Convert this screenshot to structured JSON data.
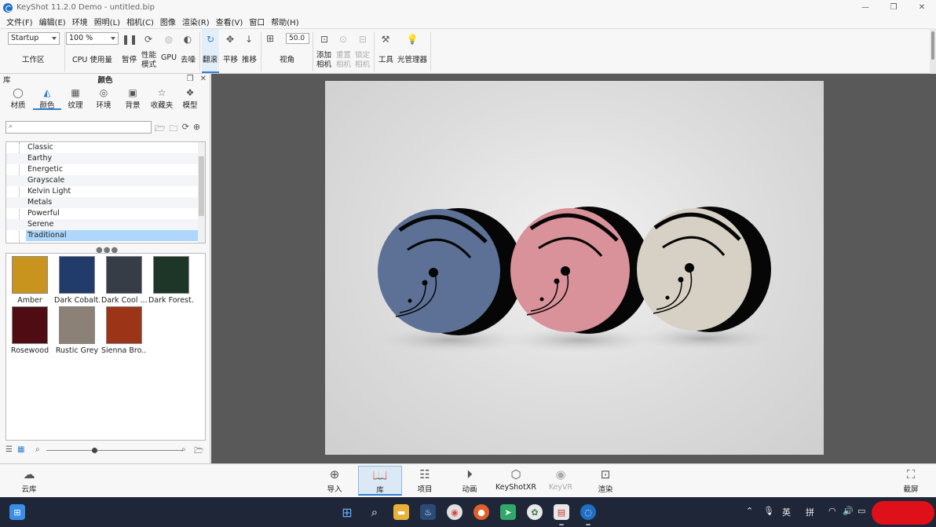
{
  "window": {
    "title": "KeyShot 11.2.0 Demo - untitled.bip",
    "controls": {
      "minimize": "—",
      "restore": "❐",
      "close": "✕"
    }
  },
  "menu": [
    "文件(F)",
    "编辑(E)",
    "环境",
    "照明(L)",
    "相机(C)",
    "图像",
    "渲染(R)",
    "查看(V)",
    "窗口",
    "帮助(H)"
  ],
  "toolbar": {
    "workspace_value": "Startup",
    "workspace_label": "工作区",
    "cpu_value": "100 %",
    "cpu_label": "CPU 使用量",
    "pause_label": "暂停",
    "perf_label_1": "性能",
    "perf_label_2": "模式",
    "gpu_label": "GPU",
    "denoise_label": "去噪",
    "tumble_label": "翻滚",
    "pan_label": "平移",
    "dolly_label": "推移",
    "fov_value": "50.0",
    "fov_label": "视角",
    "add_cam_1": "添加",
    "add_cam_2": "相机",
    "reset_cam_1": "重置",
    "reset_cam_2": "相机",
    "lock_cam_1": "锁定",
    "lock_cam_2": "相机",
    "tools_label": "工具",
    "light_manager_label": "光管理器"
  },
  "library": {
    "header_left": "库",
    "header_title": "颜色",
    "tabs": [
      {
        "label": "材质",
        "icon": "material-icon"
      },
      {
        "label": "颜色",
        "icon": "color-icon"
      },
      {
        "label": "纹理",
        "icon": "texture-icon"
      },
      {
        "label": "环境",
        "icon": "environment-icon"
      },
      {
        "label": "背景",
        "icon": "background-icon"
      },
      {
        "label": "收藏夹",
        "icon": "favorites-icon"
      },
      {
        "label": "模型",
        "icon": "models-icon"
      }
    ],
    "search_placeholder": "",
    "tree": [
      "Classic",
      "Earthy",
      "Energetic",
      "Grayscale",
      "Kelvin Light",
      "Metals",
      "Powerful",
      "Serene",
      "Traditional"
    ],
    "selected_tree": "Traditional",
    "swatches": [
      {
        "label": "Amber",
        "color": "#c8941e"
      },
      {
        "label": "Dark Cobalt...",
        "color": "#213c6a"
      },
      {
        "label": "Dark Cool ...",
        "color": "#363d46"
      },
      {
        "label": "Dark Forest...",
        "color": "#1d3627"
      },
      {
        "label": "Rosewood",
        "color": "#4f0c12"
      },
      {
        "label": "Rustic Grey",
        "color": "#8b8177"
      },
      {
        "label": "Sienna Bro...",
        "color": "#9c3418"
      }
    ],
    "thumb_size": 0.35
  },
  "dock": {
    "cloud_label": "云库",
    "items": [
      {
        "label": "导入",
        "icon": "import-icon"
      },
      {
        "label": "库",
        "icon": "library-icon"
      },
      {
        "label": "项目",
        "icon": "project-icon"
      },
      {
        "label": "动画",
        "icon": "animation-icon"
      },
      {
        "label": "KeyShotXR",
        "icon": "keyshotxr-icon"
      },
      {
        "label": "KeyVR",
        "icon": "keyvr-icon"
      },
      {
        "label": "渲染",
        "icon": "render-icon"
      }
    ],
    "screenshot_label": "截屏"
  },
  "taskbar": {
    "ime_lang": "英",
    "ime_mode": "拼"
  },
  "scene": {
    "discs": [
      {
        "face": "#5d7196"
      },
      {
        "face": "#d9919a"
      },
      {
        "face": "#d6d1c4"
      }
    ]
  }
}
